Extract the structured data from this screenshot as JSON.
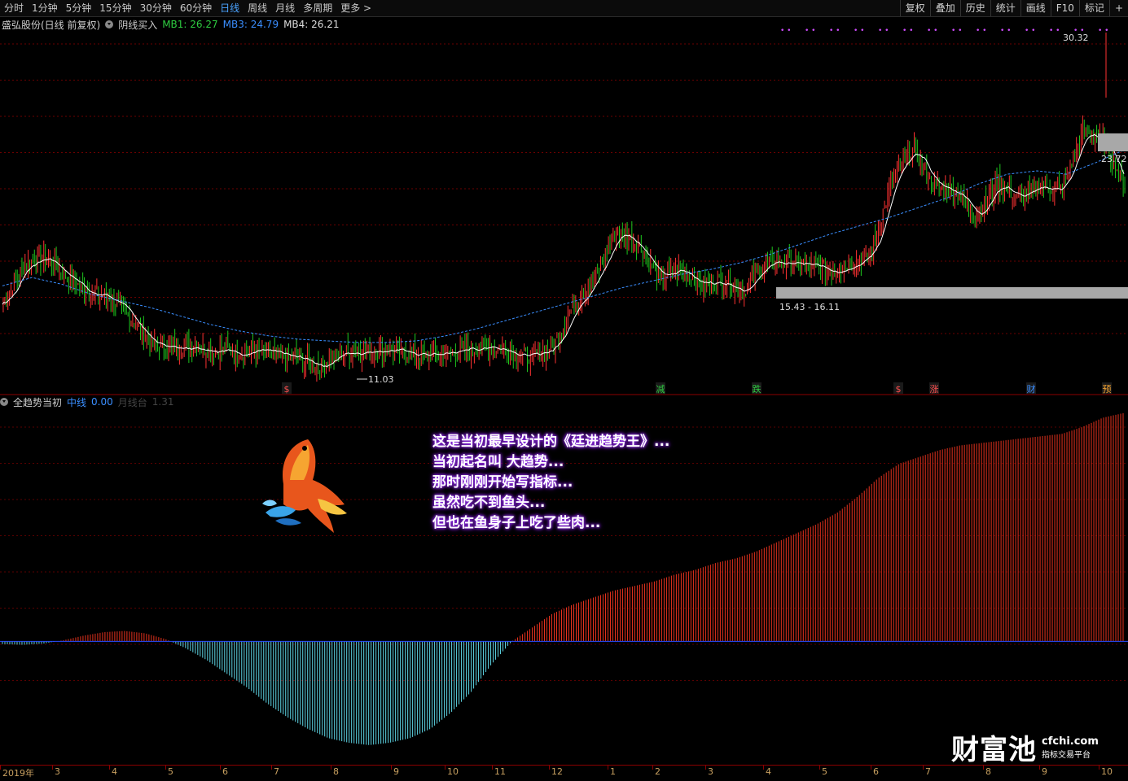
{
  "toolbar": {
    "periods": [
      "分时",
      "1分钟",
      "5分钟",
      "15分钟",
      "30分钟",
      "60分钟",
      "日线",
      "周线",
      "月线",
      "多周期",
      "更多 >"
    ],
    "active_period": "日线",
    "tools": [
      "复权",
      "叠加",
      "历史",
      "统计",
      "画线",
      "F10",
      "标记",
      "+"
    ]
  },
  "main_info": {
    "stock": "盛弘股份(日线 前复权)",
    "indicator": "阴线买入",
    "mb1": "MB1: 26.27",
    "mb3": "MB3: 24.79",
    "mb4": "MB4: 26.21"
  },
  "main_labels": {
    "high": "30.32",
    "low": "11.03",
    "range": "15.43 - 16.11",
    "right_price": "23.72"
  },
  "event_markers": [
    "$",
    "减",
    "跌",
    "$",
    "涨",
    "财",
    "预"
  ],
  "sub_info": {
    "name": "全趋势当初",
    "line_label": "中线",
    "line_value": "0.00",
    "extra": "月线台",
    "extra_value": "1.31"
  },
  "caption_lines": [
    "这是当初最早设计的《廷进趋势王》...",
    "当初起名叫 大趋势...",
    "那时刚刚开始写指标...",
    "虽然吃不到鱼头...",
    "但也在鱼身子上吃了些肉..."
  ],
  "watermark": {
    "brand": "财富池",
    "url": "cfchi.com",
    "tagline": "指标交易平台"
  },
  "date_axis": [
    "2019年",
    "3",
    "4",
    "5",
    "6",
    "7",
    "8",
    "9",
    "10",
    "11",
    "12",
    "1",
    "2",
    "3",
    "4",
    "5",
    "6",
    "7",
    "8",
    "9",
    "10"
  ],
  "colors": {
    "up": "#ff3232",
    "down": "#00e6e6",
    "ma": "#ffffff",
    "ma_long": "#3a8eff",
    "accent": "#4aa3ff"
  },
  "chart_data": {
    "type": "candlestick",
    "title": "盛弘股份(日线 前复权)",
    "close_path": [
      14.8,
      17.2,
      17.6,
      16.5,
      15.5,
      15.2,
      14.0,
      12.4,
      12.2,
      12.3,
      12.1,
      11.9,
      12.0,
      11.7,
      11.5,
      11.1,
      11.9,
      12.0,
      12.1,
      11.9,
      11.7,
      11.9,
      12.1,
      12.3,
      12.0,
      11.6,
      12.3,
      14.9,
      16.4,
      19.2,
      18.4,
      16.3,
      16.9,
      16.0,
      16.2,
      15.6,
      17.2,
      17.3,
      17.1,
      16.8,
      17.2,
      17.8,
      22.2,
      24.1,
      21.9,
      21.6,
      20.1,
      22.1,
      21.1,
      21.9,
      21.6,
      25.1,
      24.6,
      21.8
    ],
    "ylim": [
      10.5,
      31.0
    ],
    "ma_long_path": [
      15.9,
      16.4,
      16.0,
      15.4,
      15.0,
      14.6,
      14.1,
      13.6,
      13.2,
      12.9,
      12.7,
      12.6,
      12.5,
      12.5,
      12.6,
      12.9,
      13.3,
      13.8,
      14.3,
      14.8,
      15.3,
      15.8,
      16.2,
      16.6,
      16.9,
      17.3,
      17.8,
      18.4,
      19.0,
      19.5,
      20.0,
      20.6,
      21.2,
      22.0,
      22.6,
      22.8,
      22.6,
      23.3,
      24.1
    ],
    "oscillator": {
      "name": "全趋势当初",
      "values": [
        -1.2,
        -1.5,
        -1.0,
        0.5,
        2.5,
        4.0,
        4.5,
        3.5,
        1.0,
        -3,
        -8,
        -14,
        -20,
        -27,
        -33,
        -38,
        -42,
        -44,
        -45,
        -44,
        -42,
        -38,
        -31,
        -22,
        -10,
        0,
        6,
        12,
        16,
        19,
        22,
        24,
        26,
        29,
        31,
        34,
        36,
        39,
        43,
        47,
        51,
        56,
        63,
        71,
        77,
        80,
        83,
        85,
        86,
        87,
        88,
        89,
        90,
        93,
        97,
        99
      ],
      "ylim": [
        -50,
        100
      ],
      "zero": 0
    }
  }
}
